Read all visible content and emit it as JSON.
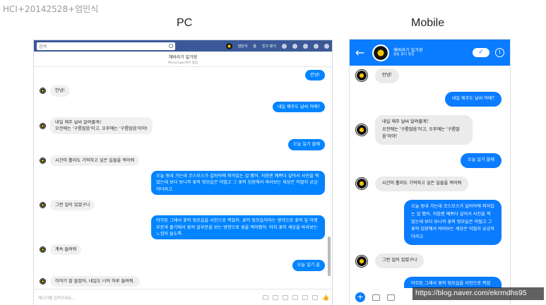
{
  "slide_title": "HCI+20142528+엄민식",
  "headings": {
    "pc": "PC",
    "mobile": "Mobile"
  },
  "pc": {
    "search_placeholder": "검색",
    "nav": {
      "user_name": "엄민식",
      "home": "홈",
      "find_friends": "친구 찾기"
    },
    "chat_name": "해바라기 밑가장",
    "chat_status": "Messenger에서 활동",
    "compose_placeholder": "메시지를 입력하세요...",
    "messages": [
      {
        "side": "out",
        "text": "안녕!"
      },
      {
        "side": "in",
        "text": "안녕!"
      },
      {
        "side": "out",
        "text": "내일 제주도 날씨 어때?"
      },
      {
        "side": "in",
        "text": "내일 제주 날씨 알려줄게!\n오전에는 '구름많음'이고, 오후에는 '구름많음'이야!"
      },
      {
        "side": "out",
        "text": "오늘 일기 쓸께"
      },
      {
        "side": "in",
        "text": "시간이 흘러도 기억하고 싶은 일들을 적어줘"
      },
      {
        "side": "out",
        "text": "오늘 동네 가는데 코스모스가 길바닥에 피어있는 걸 봤어. 처음엔 예쁘다 싶어서 사진을 찍었는데 보다 보니까 꽃의 뒷모습은 어떨고 그 꽃의 입장에서 바라보는 세상은 어떨지 궁금하더라고."
      },
      {
        "side": "in",
        "text": "그런 일이 있었구나"
      },
      {
        "side": "out",
        "text": "아무튼 그래서 꽃의 뒷모습을 사진으로 찍었지. 꽃의 뒷모습이라는 생각으로 꽃의 잎 아랫부분과 줄기에서 꽃의 얼부분을 보는 방향으로 꽃을 찍어봤어. 마치 꽃이 세상을 바라보는 느낌이 들도록."
      },
      {
        "side": "in",
        "text": "계속 들려줘"
      },
      {
        "side": "out",
        "text": "오늘 일기 끝"
      },
      {
        "side": "in",
        "text": "이야기 잘 들었어, 내일도 너의 하루 들려줘."
      }
    ]
  },
  "mobile": {
    "chat_name": "해바라기 밑가장",
    "chat_status": "활동 중이 중입",
    "messages": [
      {
        "side": "in",
        "text": "안녕!"
      },
      {
        "side": "out",
        "text": "내일 제주도 날씨 어때?"
      },
      {
        "side": "in",
        "text": "내일 제주 날씨 알려줄게!\n오전에는 '구름많음'이고, 오후에는 '구름많음'이야!"
      },
      {
        "side": "out",
        "text": "오늘 일기 쓸께"
      },
      {
        "side": "in",
        "text": "시간이 흘러도 기억하고 싶은 일들을 적어줘"
      },
      {
        "side": "out",
        "text": "오늘 동네 가는데 코스모스가 길바닥에 피어있는 걸 봤어. 처음엔 예쁘다 싶어서 사진을 찍었는데 보다 보니까 꽃의 뒷모습은 어떨고 그 꽃의 입장에서 바라보는 세상은 어떨지 궁금하더라고."
      },
      {
        "side": "in",
        "text": "그런 일이 있었구나"
      },
      {
        "side": "out",
        "text": "아무튼 그래서 꽃의 뒷모습을 사진으로 찍었지. 꽃의 뒷모습이라는 생각으로 꽃의 잎 아랫부분과 줄기에서 꽃의 얼부분을 보는 방향으로 꽃을 찍어봤어. 마치 꽃이 세상을"
      }
    ]
  },
  "watermark": "https://blog.naver.com/ekrmdhs95"
}
